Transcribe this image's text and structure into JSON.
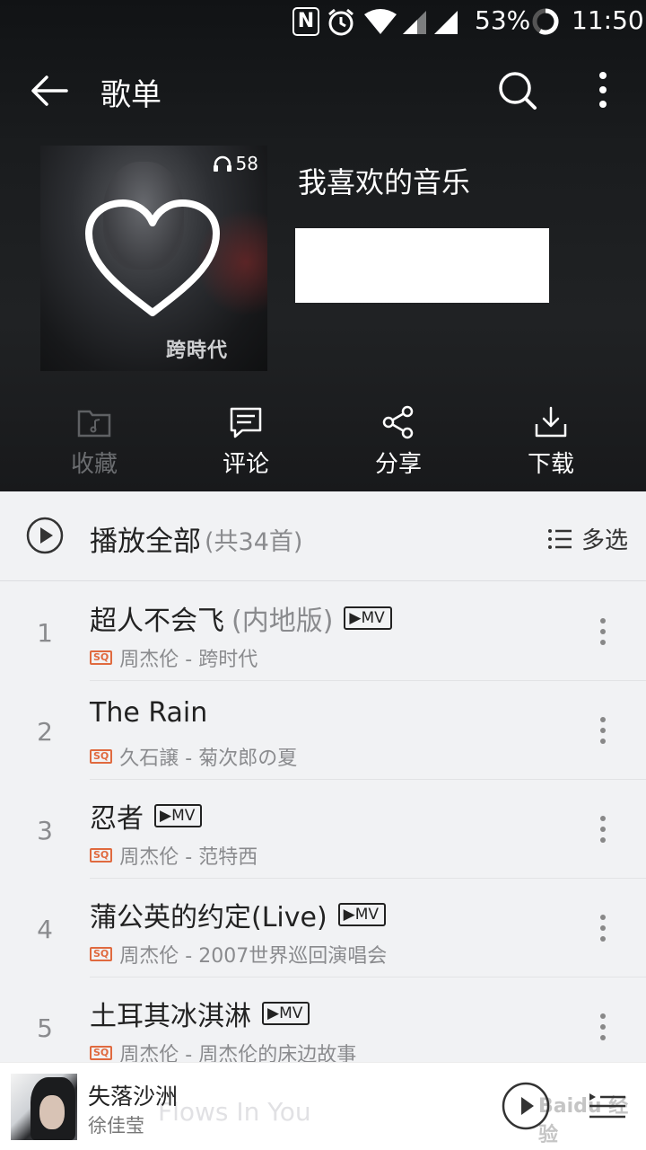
{
  "status_bar": {
    "nfc": "N",
    "battery_pct": "53%",
    "time": "11:50"
  },
  "header": {
    "title": "歌单"
  },
  "playlist": {
    "name": "我喜欢的音乐",
    "play_count": "58",
    "cover_text": "跨時代"
  },
  "actions": {
    "collect": "收藏",
    "comment": "评论",
    "share": "分享",
    "download": "下载"
  },
  "play_all": {
    "label": "播放全部",
    "count": "(共34首)",
    "multi_select": "多选"
  },
  "songs": [
    {
      "index": "1",
      "title": "超人不会飞",
      "suffix": "(内地版)",
      "mv": "▶MV",
      "quality": "SQ",
      "artist": "周杰伦 - 跨时代"
    },
    {
      "index": "2",
      "title": "The Rain",
      "suffix": "",
      "mv": "",
      "quality": "SQ",
      "artist": "久石譲 - 菊次郎の夏"
    },
    {
      "index": "3",
      "title": "忍者",
      "suffix": "",
      "mv": "▶MV",
      "quality": "SQ",
      "artist": "周杰伦 - 范特西"
    },
    {
      "index": "4",
      "title": "蒲公英的约定(Live)",
      "suffix": "",
      "mv": "▶MV",
      "quality": "SQ",
      "artist": "周杰伦 - 2007世界巡回演唱会"
    },
    {
      "index": "5",
      "title": "土耳其冰淇淋",
      "suffix": "",
      "mv": "▶MV",
      "quality": "SQ",
      "artist": "周杰伦 - 周杰伦的床边故事"
    }
  ],
  "mini_player": {
    "title": "失落沙洲",
    "artist": "徐佳莹",
    "ghost_text": "Flows In You"
  },
  "watermark": "Baidu 经验",
  "colors": {
    "quality_badge": "#e06a3f",
    "header_bg": "#1a1c1e",
    "list_bg": "#f1f2f4"
  }
}
